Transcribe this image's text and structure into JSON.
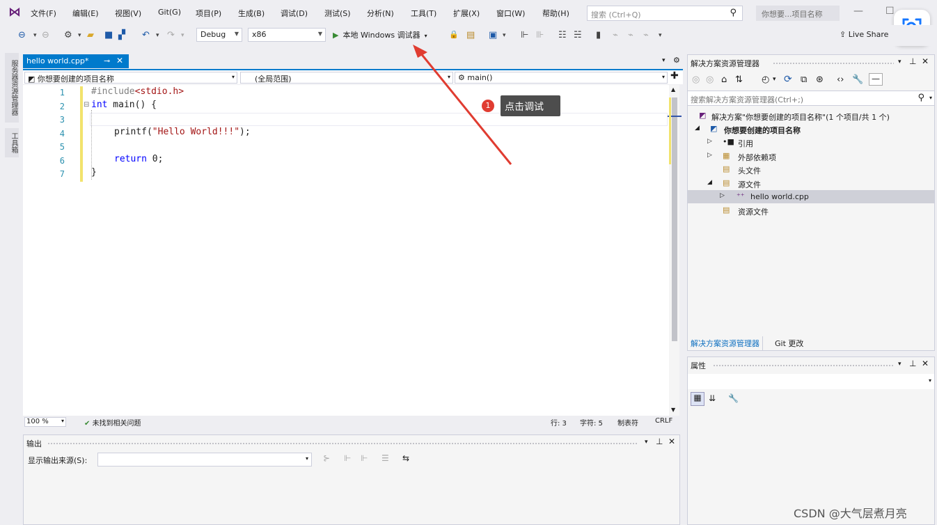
{
  "menubar": {
    "items": [
      "文件(F)",
      "编辑(E)",
      "视图(V)",
      "Git(G)",
      "项目(P)",
      "生成(B)",
      "调试(D)",
      "测试(S)",
      "分析(N)",
      "工具(T)",
      "扩展(X)",
      "窗口(W)",
      "帮助(H)"
    ],
    "search_placeholder": "搜索 (Ctrl+Q)",
    "project_badge": "你想要...项目名称"
  },
  "toolbar": {
    "config": "Debug",
    "platform": "x86",
    "start_debug": "本地 Windows 调试器",
    "live_share": "Live Share"
  },
  "left_rail": [
    "服务器资源管理器",
    "工具箱"
  ],
  "editor": {
    "tab_title": "hello world.cpp*",
    "nav_project": "你想要创建的项目名称",
    "nav_scope": "(全局范围)",
    "nav_member": "main()",
    "line_numbers": [
      "1",
      "2",
      "3",
      "4",
      "5",
      "6",
      "7"
    ],
    "code": {
      "l1_pre": "#include",
      "l1_hdr": "<stdio.h>",
      "l2_kw": "int",
      "l2_rest": " main() {",
      "l4_fn": "printf(",
      "l4_str": "\"Hello World!!!\"",
      "l4_end": ");",
      "l6_kw": "return",
      "l6_rest": " 0;",
      "l7": "}"
    },
    "zoom": "100 %",
    "issues": "未找到相关问题",
    "line_col": "行: 3",
    "char_col": "字符: 5",
    "tabs_mode": "制表符",
    "eol": "CRLF"
  },
  "callout": {
    "number": "1",
    "text": "点击调试"
  },
  "solution_explorer": {
    "title": "解决方案资源管理器",
    "search_placeholder": "搜索解决方案资源管理器(Ctrl+;)",
    "tree": [
      "解决方案\"你想要创建的项目名称\"(1 个项目/共 1 个)",
      "你想要创建的项目名称",
      "引用",
      "外部依赖项",
      "头文件",
      "源文件",
      "hello world.cpp",
      "资源文件"
    ],
    "tab_active": "解决方案资源管理器",
    "tab_other": "Git 更改"
  },
  "properties": {
    "title": "属性"
  },
  "output": {
    "title": "输出",
    "source_label": "显示输出来源(S):"
  },
  "watermark": "CSDN @大气层煮月亮",
  "colors": {
    "accent": "#007acc",
    "arrow": "#e03c31",
    "callout_bg": "#4d4d4d",
    "keyword": "#0000ff",
    "string": "#a31515"
  }
}
